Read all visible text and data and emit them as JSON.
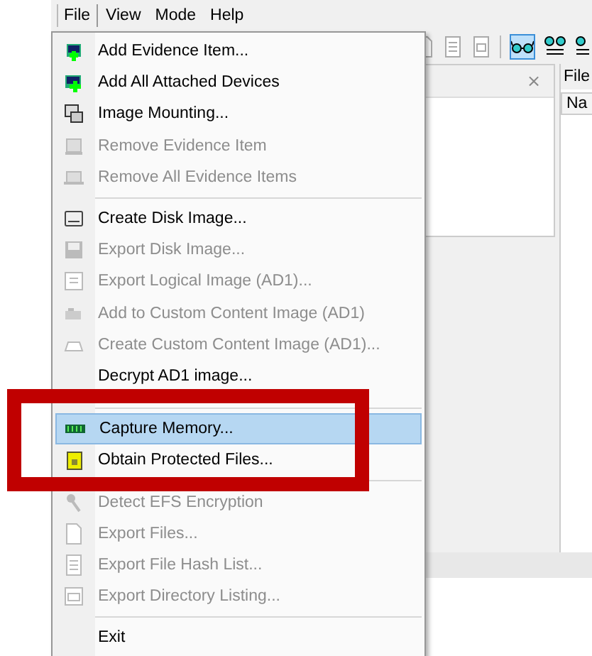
{
  "menubar": [
    {
      "label": "File",
      "selected": true
    },
    {
      "label": "View",
      "selected": false
    },
    {
      "label": "Mode",
      "selected": false
    },
    {
      "label": "Help",
      "selected": false
    }
  ],
  "file_menu": [
    {
      "kind": "item",
      "label": "Add Evidence Item...",
      "disabled": false,
      "selected": false
    },
    {
      "kind": "item",
      "label": "Add All Attached Devices",
      "disabled": false,
      "selected": false
    },
    {
      "kind": "item",
      "label": "Image Mounting...",
      "disabled": false,
      "selected": false
    },
    {
      "kind": "item",
      "label": "Remove Evidence Item",
      "disabled": true,
      "selected": false
    },
    {
      "kind": "item",
      "label": "Remove All Evidence Items",
      "disabled": true,
      "selected": false
    },
    {
      "kind": "separator"
    },
    {
      "kind": "item",
      "label": "Create Disk Image...",
      "disabled": false,
      "selected": false
    },
    {
      "kind": "item",
      "label": "Export Disk Image...",
      "disabled": true,
      "selected": false
    },
    {
      "kind": "item",
      "label": "Export Logical Image (AD1)...",
      "disabled": true,
      "selected": false
    },
    {
      "kind": "item",
      "label": "Add to Custom Content Image (AD1)",
      "disabled": true,
      "selected": false
    },
    {
      "kind": "item",
      "label": "Create Custom Content Image (AD1)...",
      "disabled": true,
      "selected": false
    },
    {
      "kind": "item",
      "label": "Decrypt AD1 image...",
      "disabled": false,
      "selected": false
    },
    {
      "kind": "gap"
    },
    {
      "kind": "separator"
    },
    {
      "kind": "item",
      "label": "Capture Memory...",
      "disabled": false,
      "selected": true
    },
    {
      "kind": "item",
      "label": "Obtain Protected Files...",
      "disabled": false,
      "selected": false
    },
    {
      "kind": "separator"
    },
    {
      "kind": "item",
      "label": "Detect EFS Encryption",
      "disabled": true,
      "selected": false
    },
    {
      "kind": "item",
      "label": "Export Files...",
      "disabled": true,
      "selected": false
    },
    {
      "kind": "item",
      "label": "Export File Hash List...",
      "disabled": true,
      "selected": false
    },
    {
      "kind": "item",
      "label": "Export Directory Listing...",
      "disabled": true,
      "selected": false
    },
    {
      "kind": "separator"
    },
    {
      "kind": "item",
      "label": "Exit",
      "disabled": false,
      "selected": false
    }
  ],
  "file_list_panel": {
    "tab": "File",
    "column_1": "Na"
  },
  "viewer_panel": {
    "close": "×"
  }
}
